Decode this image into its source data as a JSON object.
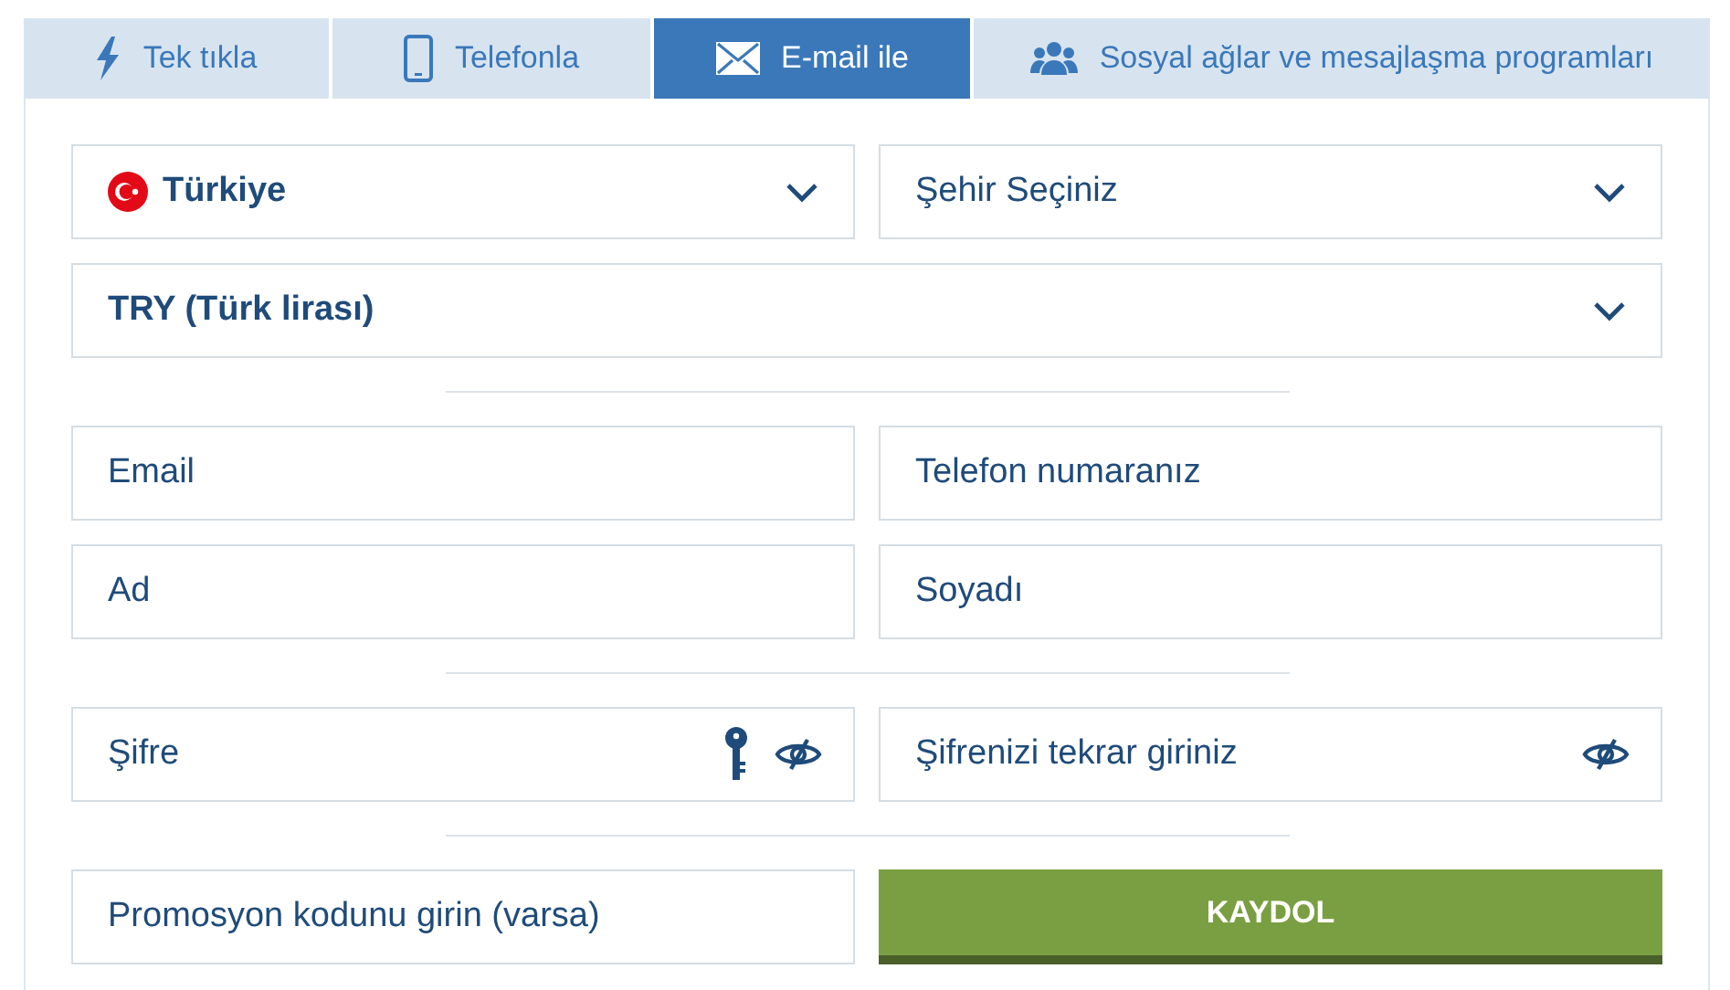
{
  "tabs": [
    {
      "label": "Tek tıkla",
      "selected": false
    },
    {
      "label": "Telefonla",
      "selected": false
    },
    {
      "label": "E-mail ile",
      "selected": true
    },
    {
      "label": "Sosyal ağlar ve mesajlaşma programları",
      "selected": false
    }
  ],
  "rows": [
    {
      "kind": "fields",
      "fields": [
        {
          "kind": "select",
          "value": "Türkiye",
          "flag": true
        },
        {
          "kind": "select",
          "placeholder": "Şehir Seçiniz"
        }
      ]
    },
    {
      "kind": "fields",
      "fields": [
        {
          "kind": "select",
          "value": "TRY (Türk lirası)"
        }
      ]
    },
    {
      "kind": "divider"
    },
    {
      "kind": "fields",
      "fields": [
        {
          "kind": "input",
          "placeholder": "Email"
        },
        {
          "kind": "input",
          "placeholder": "Telefon numaranız"
        }
      ]
    },
    {
      "kind": "fields",
      "fields": [
        {
          "kind": "input",
          "placeholder": "Ad"
        },
        {
          "kind": "input",
          "placeholder": "Soyadı"
        }
      ]
    },
    {
      "kind": "divider"
    },
    {
      "kind": "fields",
      "fields": [
        {
          "kind": "password",
          "placeholder": "Şifre",
          "key": true
        },
        {
          "kind": "password",
          "placeholder": "Şifrenizi tekrar giriniz",
          "key": false
        }
      ]
    },
    {
      "kind": "divider"
    },
    {
      "kind": "fields",
      "fields": [
        {
          "kind": "input",
          "placeholder": "Promosyon kodunu girin (varsa)"
        },
        {
          "kind": "button",
          "label": "KAYDOL"
        }
      ]
    }
  ]
}
